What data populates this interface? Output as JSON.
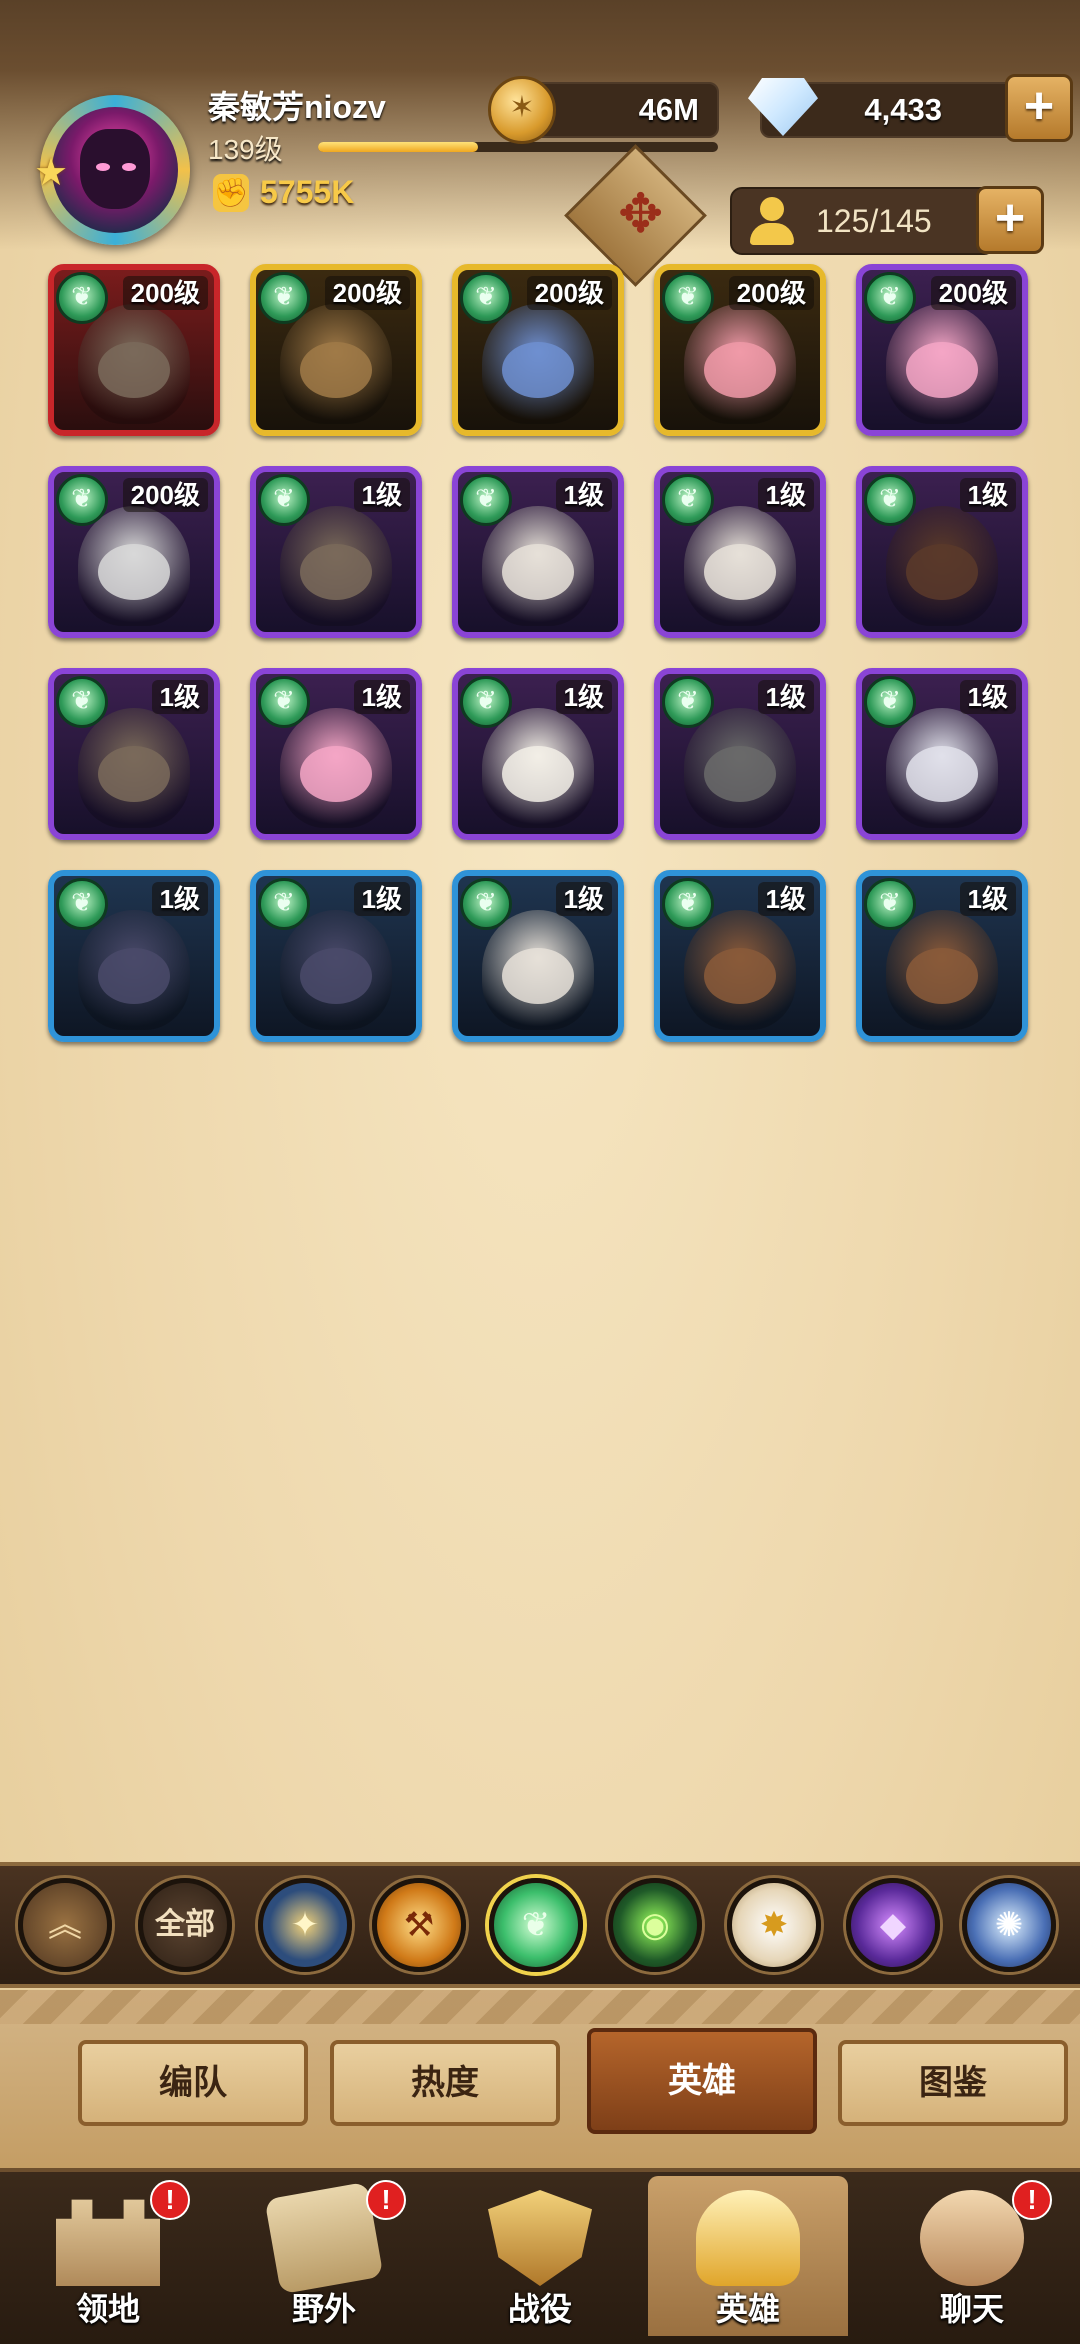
{
  "player": {
    "name": "秦敏芳niozv",
    "level_label": "139级",
    "xp_progress": 0.4,
    "power": "5755K"
  },
  "resources": {
    "gold": "46M",
    "diamonds": "4,433"
  },
  "roster": {
    "count": "125/145"
  },
  "heroes": [
    {
      "level": "200级",
      "rarity": "red",
      "tint": "#7a6a5a"
    },
    {
      "level": "200级",
      "rarity": "gold",
      "tint": "#a07a48"
    },
    {
      "level": "200级",
      "rarity": "gold",
      "tint": "#6f8fd0"
    },
    {
      "level": "200级",
      "rarity": "gold",
      "tint": "#f09aa8"
    },
    {
      "level": "200级",
      "rarity": "purple",
      "tint": "#f4a6c6"
    },
    {
      "level": "200级",
      "rarity": "purple",
      "tint": "#d8d8d8"
    },
    {
      "level": "1级",
      "rarity": "purple",
      "tint": "#7a6a5a"
    },
    {
      "level": "1级",
      "rarity": "purple",
      "tint": "#e6e0d8"
    },
    {
      "level": "1级",
      "rarity": "purple",
      "tint": "#e6e0d8"
    },
    {
      "level": "1级",
      "rarity": "purple",
      "tint": "#5a3a2a"
    },
    {
      "level": "1级",
      "rarity": "purple",
      "tint": "#7a6a5a"
    },
    {
      "level": "1级",
      "rarity": "purple",
      "tint": "#f4a6c6"
    },
    {
      "level": "1级",
      "rarity": "purple",
      "tint": "#f2eee6"
    },
    {
      "level": "1级",
      "rarity": "purple",
      "tint": "#6a6a6a"
    },
    {
      "level": "1级",
      "rarity": "purple",
      "tint": "#e0e0ea"
    },
    {
      "level": "1级",
      "rarity": "blue",
      "tint": "#4a4a6a"
    },
    {
      "level": "1级",
      "rarity": "blue",
      "tint": "#4a4a6a"
    },
    {
      "level": "1级",
      "rarity": "blue",
      "tint": "#e6e0d8"
    },
    {
      "level": "1级",
      "rarity": "blue",
      "tint": "#8a5a3a"
    },
    {
      "level": "1级",
      "rarity": "blue",
      "tint": "#8a5a3a"
    }
  ],
  "filters": {
    "all_label": "全部",
    "up_glyph": "︽",
    "light_glyph": "✦",
    "mauler_glyph": "⚒",
    "wild_glyph": "❦",
    "grave_glyph": "◉",
    "celes_glyph": "✸",
    "hypo_glyph": "◆",
    "dim_glyph": "✺"
  },
  "subtabs": [
    "编队",
    "热度",
    "英雄",
    "图鉴"
  ],
  "nav": [
    "领地",
    "野外",
    "战役",
    "英雄",
    "聊天"
  ],
  "badge_glyph": "!"
}
